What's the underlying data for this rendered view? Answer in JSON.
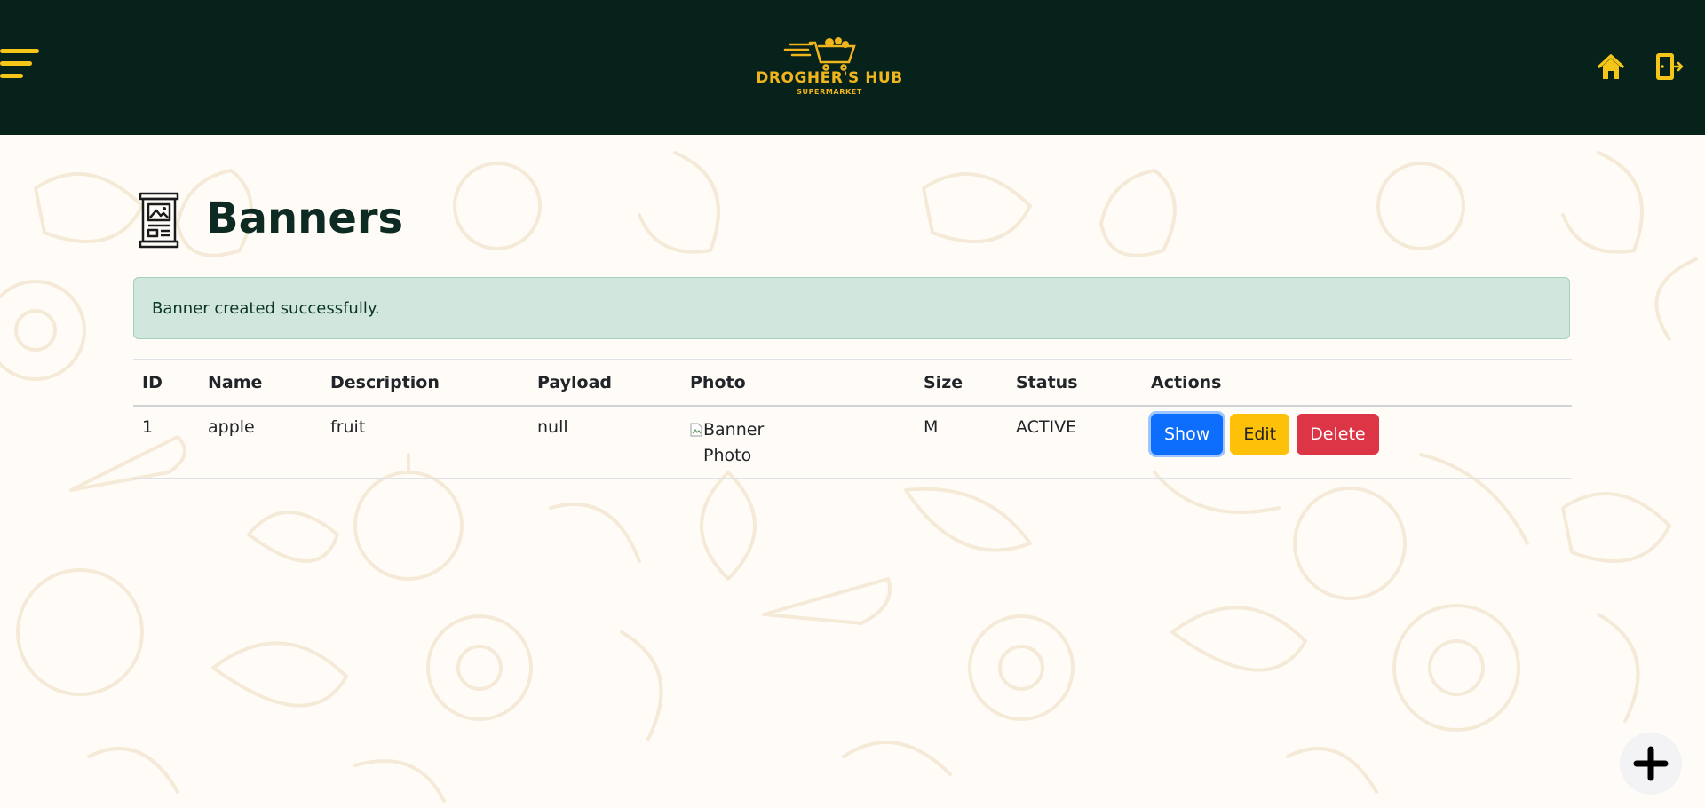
{
  "header": {
    "logo_text": "DROGHER'S HUB",
    "logo_subtext": "SUPERMARKET",
    "menu_icon": "hamburger-icon",
    "home_icon": "home-icon",
    "logout_icon": "logout-icon",
    "accent_color": "#f5c518",
    "bg_color": "#06221a"
  },
  "page": {
    "title": "Banners",
    "title_icon": "banner-icon"
  },
  "alert": {
    "message": "Banner created successfully.",
    "type": "success"
  },
  "table": {
    "columns": [
      "ID",
      "Name",
      "Description",
      "Payload",
      "Photo",
      "Size",
      "Status",
      "Actions"
    ],
    "rows": [
      {
        "id": "1",
        "name": "apple",
        "description": "fruit",
        "payload": "null",
        "photo_alt": "Banner Photo",
        "size": "M",
        "status": "ACTIVE",
        "actions": {
          "show": "Show",
          "edit": "Edit",
          "delete": "Delete"
        }
      }
    ]
  },
  "fab": {
    "icon": "plus-icon"
  }
}
